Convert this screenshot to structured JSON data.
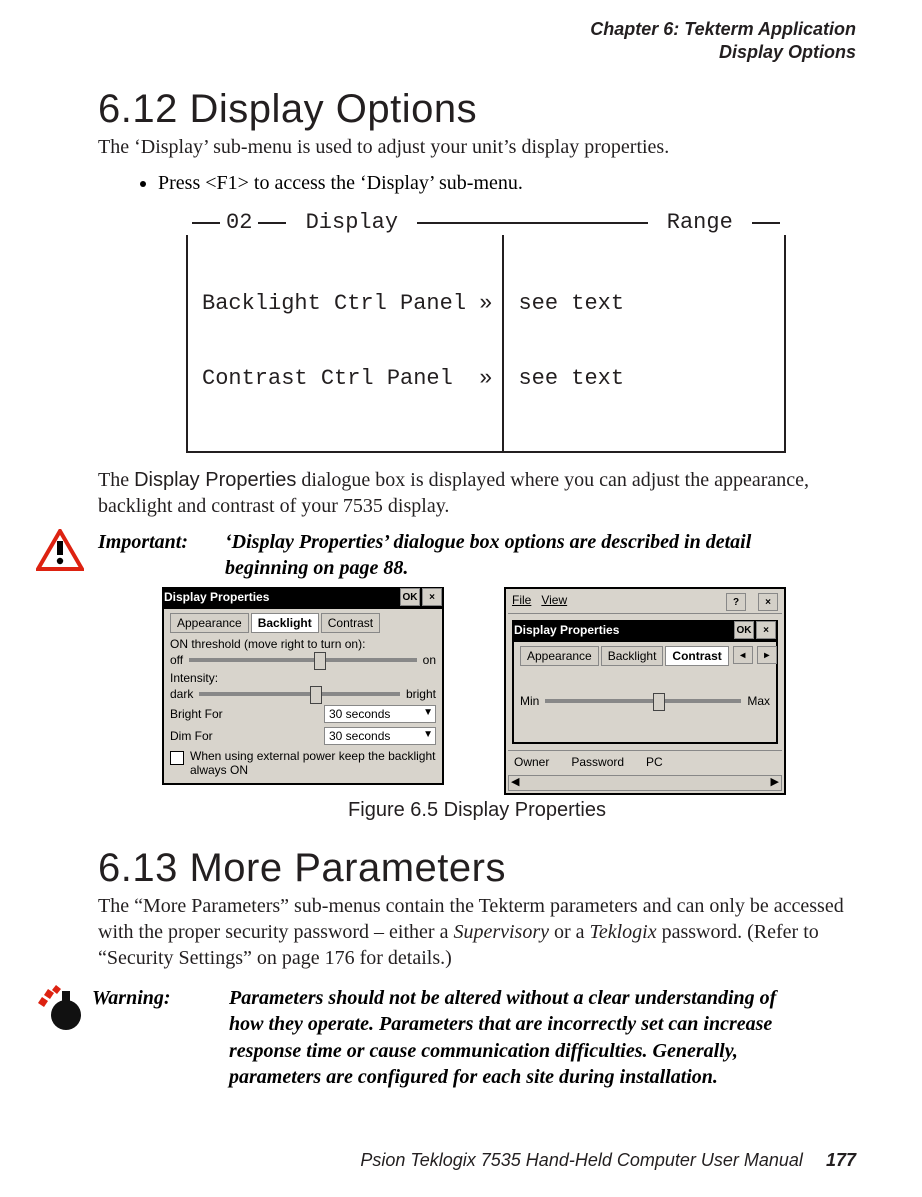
{
  "header": {
    "chapter_line": "Chapter 6: Tekterm Application",
    "section_line": "Display Options"
  },
  "s612": {
    "title": "6.12  Display Options",
    "intro": "The ‘Display’ sub-menu is used to adjust your unit’s display properties.",
    "bullet": "Press <F1> to access the ‘Display’ sub-menu.",
    "menu": {
      "legend_left": "02",
      "legend_mid": "Display",
      "legend_right": "Range",
      "rows": [
        {
          "left": "Backlight Ctrl Panel »",
          "right": "see text"
        },
        {
          "left": "Contrast Ctrl Panel  »",
          "right": "see text"
        }
      ]
    },
    "para2_a": "The ",
    "para2_b": "Display Properties",
    "para2_c": " dialogue box is displayed where you can adjust the appearance, backlight and contrast of your 7535 display.",
    "important_label": "Important:",
    "important_body": "‘Display Properties’ dialogue box options are described in detail beginning on page 88."
  },
  "shots": {
    "win1": {
      "title": "Display Properties",
      "ok": "OK",
      "close": "×",
      "tabs": [
        "Appearance",
        "Backlight",
        "Contrast"
      ],
      "active_tab_index": 1,
      "line1": "ON threshold (move right to turn on):",
      "off": "off",
      "on": "on",
      "intensity": "Intensity:",
      "dark": "dark",
      "bright": "bright",
      "bright_for": "Bright For",
      "bright_val": "30 seconds",
      "dim_for": "Dim For",
      "dim_val": "30 seconds",
      "checkbox": "When using external power keep the backlight always ON"
    },
    "win2": {
      "menu_file": "File",
      "menu_view": "View",
      "help": "?",
      "close": "×",
      "title": "Display Properties",
      "ok": "OK",
      "tabs": [
        "Appearance",
        "Backlight",
        "Contrast"
      ],
      "active_tab_index": 2,
      "tab_left": "◂",
      "tab_right": "▸",
      "min": "Min",
      "max": "Max",
      "bottom": [
        "Owner",
        "Password",
        "PC"
      ]
    },
    "caption": "Figure 6.5 Display Properties"
  },
  "s613": {
    "title": "6.13  More Parameters",
    "para_a": "The “More Parameters” sub-menus contain the Tekterm parameters and can only be accessed with the proper security password – either a ",
    "para_b": "Supervisory",
    "para_c": " or a ",
    "para_d": "Teklogix",
    "para_e": " password. (Refer to “Security Settings” on page 176 for details.)",
    "warning_label": "Warning:",
    "warning_body": "Parameters should not be altered without a clear understanding of how they operate. Parameters that are incorrectly set can increase response time or cause communication difficulties. Generally, parameters are configured for each site during installation."
  },
  "footer": {
    "book": "Psion Teklogix 7535 Hand-Held Computer User Manual",
    "page": "177"
  }
}
